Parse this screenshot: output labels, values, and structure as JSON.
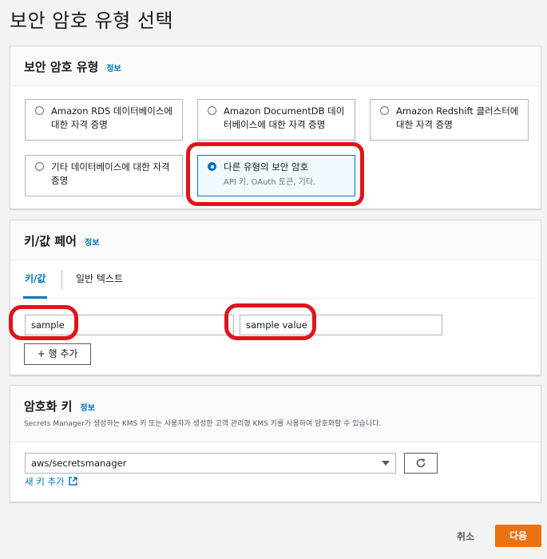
{
  "page": {
    "title": "보안 암호 유형 선택"
  },
  "secret_type": {
    "title": "보안 암호 유형",
    "info": "정보",
    "options": [
      {
        "label": "Amazon RDS 데이터베이스에 대한 자격 증명",
        "selected": false
      },
      {
        "label": "Amazon DocumentDB 데이터베이스에 대한 자격 증명",
        "selected": false
      },
      {
        "label": "Amazon Redshift 클러스터에 대한 자격 증명",
        "selected": false
      },
      {
        "label": "기타 데이터베이스에 대한 자격 증명",
        "selected": false
      },
      {
        "label": "다른 유형의 보안 암호",
        "description": "API 키, OAuth 토큰, 기타.",
        "selected": true
      }
    ]
  },
  "key_value": {
    "title": "키/값 페어",
    "info": "정보",
    "tabs": [
      "키/값",
      "일반 텍스트"
    ],
    "active_tab": "키/값",
    "row": {
      "key": "sample",
      "value": "sample value"
    },
    "add_row_label": "+ 행 추가"
  },
  "encryption": {
    "title": "암호화 키",
    "info": "정보",
    "description": "Secrets Manager가 생성하는 KMS 키 또는 사용자가 생성한 고객 관리형 KMS 키를 사용하여 암호화할 수 있습니다.",
    "selected_key": "aws/secretsmanager",
    "new_key_link": "새 키 추가"
  },
  "footer": {
    "cancel_label": "취소",
    "next_label": "다음"
  },
  "colors": {
    "accent": "#0073bb",
    "primary_button": "#ec7211",
    "annotation": "#e0141b"
  }
}
